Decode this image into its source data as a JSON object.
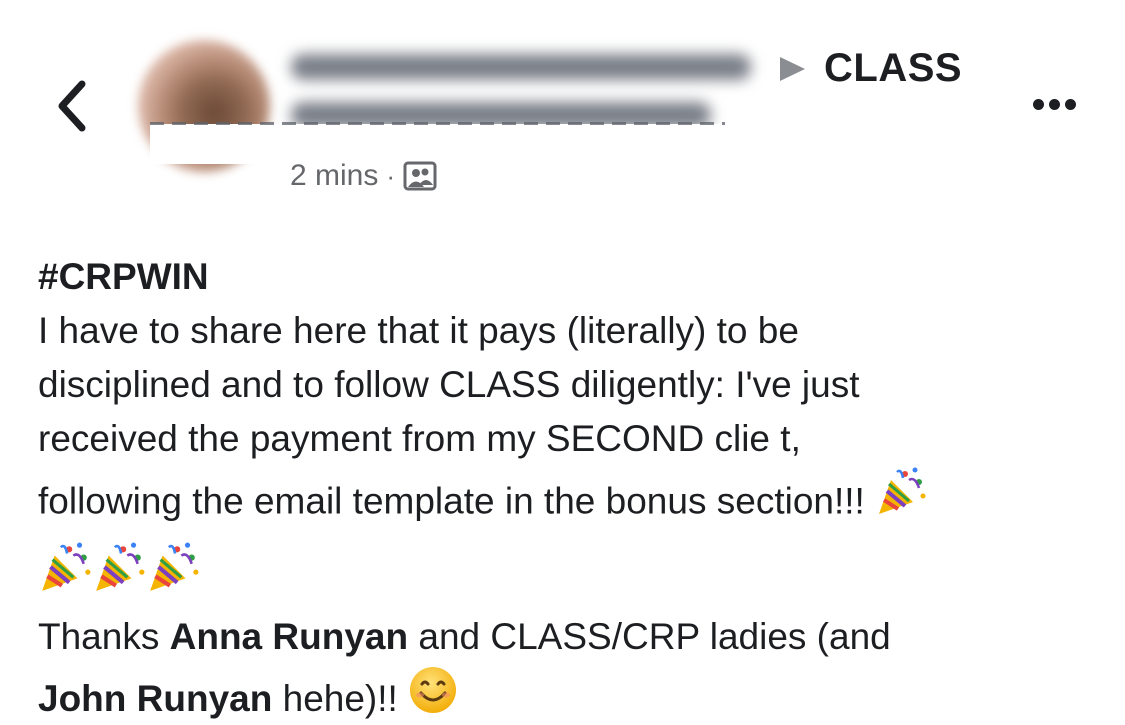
{
  "header": {
    "back_icon": "chevron-left-icon",
    "group_name": "CLASS",
    "arrow_icon": "triangle-right-icon",
    "more_icon": "more-horizontal-icon",
    "timestamp": "2 mins",
    "separator": "·",
    "audience_icon": "group-audience-icon"
  },
  "post": {
    "hashtag": "#CRPWIN",
    "line1": "I have to share here that it pays (literally) to be",
    "line2": "disciplined and to follow CLASS diligently: I've just",
    "line3": "received the payment from my SECOND clie t,",
    "line4": "following the email template in the bonus section!!!",
    "celebration_icon": "party-popper-icon",
    "thanks_prefix": "Thanks ",
    "mention1": "Anna Runyan",
    "thanks_middle": " and CLASS/CRP ladies (and",
    "mention2": "John Runyan",
    "thanks_suffix": " hehe)!!",
    "smile_icon": "smiling-face-icon"
  },
  "colors": {
    "text": "#1c1e21",
    "secondary": "#65676b",
    "background": "#ffffff",
    "arrow": "#8a8d91"
  }
}
